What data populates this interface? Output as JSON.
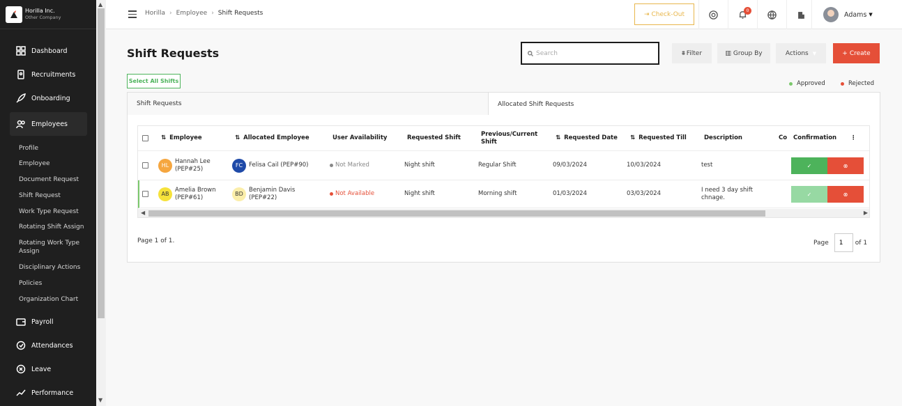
{
  "company": {
    "name": "Horilla Inc.",
    "subtitle": "Other Company"
  },
  "sidebar": {
    "items": [
      {
        "label": "Dashboard",
        "icon": "dashboard-icon"
      },
      {
        "label": "Recruitments",
        "icon": "recruitment-icon"
      },
      {
        "label": "Onboarding",
        "icon": "rocket-icon"
      },
      {
        "label": "Employees",
        "icon": "users-icon"
      },
      {
        "label": "Payroll",
        "icon": "wallet-icon"
      },
      {
        "label": "Attendances",
        "icon": "clock-icon"
      },
      {
        "label": "Leave",
        "icon": "leave-icon"
      },
      {
        "label": "Performance",
        "icon": "chart-line-icon"
      }
    ],
    "sub_items": [
      "Profile",
      "Employee",
      "Document Request",
      "Shift Request",
      "Work Type Request",
      "Rotating Shift Assign",
      "Rotating Work Type Assign",
      "Disciplinary Actions",
      "Policies",
      "Organization Chart"
    ]
  },
  "topbar": {
    "breadcrumb": [
      "Horilla",
      "Employee",
      "Shift Requests"
    ],
    "checkout_label": "Check-Out",
    "notification_count": "0",
    "user_name": "Adams"
  },
  "page": {
    "title": "Shift Requests",
    "search_placeholder": "Search",
    "filter_label": "Filter",
    "group_by_label": "Group By",
    "actions_label": "Actions",
    "create_label": "Create",
    "select_all_label": "Select All Shifts",
    "legend": [
      {
        "label": "Approved",
        "color": "#7bc86c"
      },
      {
        "label": "Rejected",
        "color": "#e54f38"
      }
    ],
    "tabs": [
      "Shift Requests",
      "Allocated Shift Requests"
    ]
  },
  "table": {
    "headers": [
      "Employee",
      "Allocated Employee",
      "User Availability",
      "Requested Shift",
      "Previous/Current Shift",
      "Requested Date",
      "Requested Till",
      "Description",
      "Co",
      "Confirmation"
    ],
    "rows": [
      {
        "emp_initials": "HL",
        "emp_name": "Hannah Lee",
        "emp_id": "(PEP#25)",
        "alloc_initials": "FC",
        "alloc_name": "Felisa Cail (PEP#90)",
        "alloc_id": "",
        "availability": "Not Marked",
        "requested_shift": "Night shift",
        "previous_shift": "Regular Shift",
        "requested_date": "09/03/2024",
        "requested_till": "10/03/2024",
        "description": "test"
      },
      {
        "emp_initials": "AB",
        "emp_name": "Amelia Brown",
        "emp_id": "(PEP#61)",
        "alloc_initials": "BD",
        "alloc_name": "Benjamin Davis",
        "alloc_id": "(PEP#22)",
        "availability": "Not Available",
        "requested_shift": "Night shift",
        "previous_shift": "Morning shift",
        "requested_date": "01/03/2024",
        "requested_till": "03/03/2024",
        "description": "I need 3 day shift chnage."
      }
    ]
  },
  "pagination": {
    "info": "Page 1 of 1.",
    "page_label": "Page",
    "page_value": "1",
    "of_label": "of 1"
  }
}
